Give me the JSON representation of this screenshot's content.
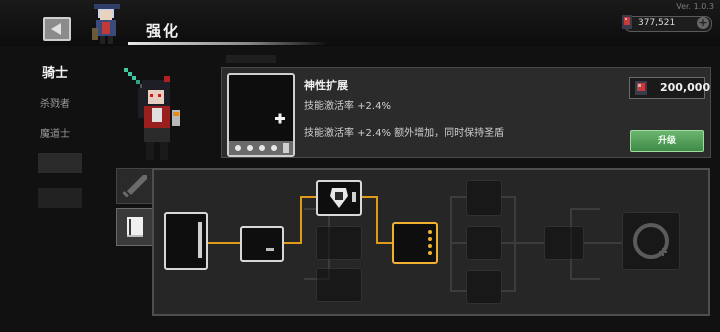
{
  "header": {
    "title": "强化",
    "version": "Ver. 1.0.3",
    "currency_value": "377,521",
    "currency_plus": "+"
  },
  "classes": [
    {
      "label": "骑士",
      "selected": true
    },
    {
      "label": "杀戮者",
      "selected": false
    },
    {
      "label": "魔道士",
      "selected": false
    }
  ],
  "skill": {
    "name": "神性扩展",
    "description_line1": "技能激活率 +2.4%",
    "description_line2": "技能激活率 +2.4% 额外增加，同时保持圣盾",
    "cost": "200,000",
    "upgrade_label": "升级",
    "level_dots_filled": 0,
    "level_dots_total": 4
  },
  "tabs": {
    "weapon_icon": "sword-icon",
    "book_icon": "book-icon"
  },
  "colors": {
    "accent_path": "#e09a1a",
    "upgrade_green": "#4fa055",
    "selected_border": "#f0b030"
  }
}
